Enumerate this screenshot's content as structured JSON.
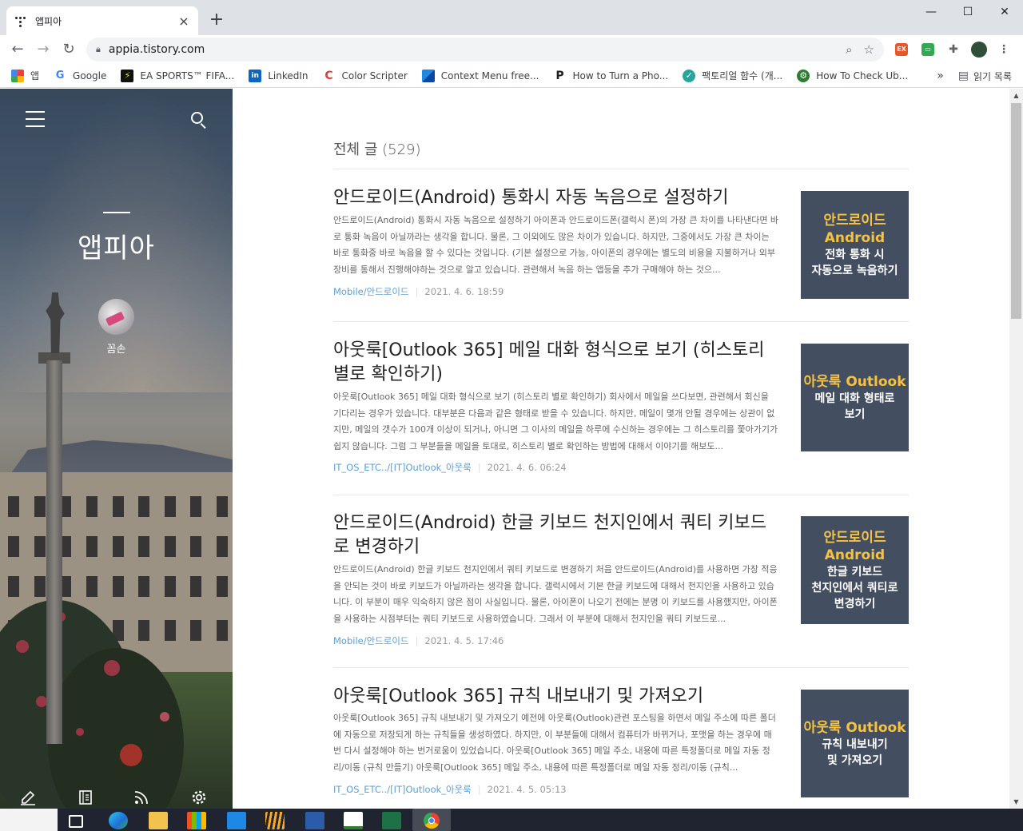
{
  "browser": {
    "tab_title": "앱피아",
    "tab_close": "×",
    "new_tab": "+",
    "window_controls": {
      "minimize": "—",
      "maximize": "☐",
      "close": "✕"
    },
    "url": "appia.tistory.com",
    "bookmarks": [
      {
        "label": "앱",
        "icon": "apps-grid-icon",
        "color": "#ea4335"
      },
      {
        "label": "Google",
        "icon": "google-icon",
        "color": "#4285f4"
      },
      {
        "label": "EA SPORTS™ FIFA...",
        "icon": "ea-sports-icon",
        "color": "#111111"
      },
      {
        "label": "LinkedIn",
        "icon": "linkedin-icon",
        "color": "#0a66c2"
      },
      {
        "label": "Color Scripter",
        "icon": "color-scripter-icon",
        "color": "#e53935"
      },
      {
        "label": "Context Menu free...",
        "icon": "context-menu-icon",
        "color": "#1e88e5"
      },
      {
        "label": "How to Turn a Pho...",
        "icon": "p-icon",
        "color": "#222222"
      },
      {
        "label": "팩토리얼 함수 (개...",
        "icon": "shield-check-icon",
        "color": "#26a69a"
      },
      {
        "label": "How To Check Ub...",
        "icon": "gear-badge-icon",
        "color": "#2e7d32"
      }
    ],
    "bookmarks_more": "»",
    "reading_list": "읽기 목록"
  },
  "blog": {
    "title": "앱피아",
    "author": "꼼손",
    "list_heading": "전체 글 (529)"
  },
  "posts": [
    {
      "title": "안드로이드(Android) 통화시 자동 녹음으로 설정하기",
      "excerpt": "안드로이드(Android) 통화시 자동 녹음으로 설정하기 아이폰과 안드로이드폰(갤럭시 폰)의 가장 큰 차이를 나타낸다면 바로 통화 녹음이 아닐까라는 생각을 합니다. 물론, 그 이외에도 많은 차이가 있습니다. 하지만, 그중에서도 가장 큰 차이는 바로 통화중 바로 녹음을 할 수 있다는 것입니다. (기본 설정으로 가능, 아이폰의 경우에는 별도의 비용을 지불하거나 외부 장비를 통해서 진행해야하는 것으로 알고 있습니다. 관련해서 녹음 하는 앱등을 추가 구매해야 하는 것으...",
      "category": "Mobile/안드로이드",
      "date": "2021. 4. 6. 18:59",
      "thumb_line1": "안드로이드\nAndroid",
      "thumb_line2": "전화 통화 시\n자동으로 녹음하기"
    },
    {
      "title": "아웃룩[Outlook 365] 메일 대화 형식으로 보기 (히스토리 별로 확인하기)",
      "excerpt": "아웃룩[Outlook 365] 메일 대화 형식으로 보기 (히스토리 별로 확인하기) 회사에서 메일을 쓰다보면, 관련해서 회신을 기다리는 경우가 있습니다. 대부분은 다음과 같은 형태로 받을 수 있습니다. 하지만, 메일이 몇개 안될 경우에는 상관이 없지만, 메일의 갯수가 100개 이상이 되거나, 아니면 그 이사의 메일을 하루에 수신하는 경우에는 그 히스토리를 쫓아가기가 쉽지 않습니다. 그럼 그 부분들을 메일을 토대로, 히스토리 별로 확인하는 방법에 대해서 이야기를 해보도...",
      "category": "IT_OS_ETC../[IT]Outlook_아웃룩",
      "date": "2021. 4. 6. 06:24",
      "thumb_line1": "아웃룩 Outlook",
      "thumb_line2": "메일 대화 형태로\n보기"
    },
    {
      "title": "안드로이드(Android) 한글 키보드 천지인에서 쿼티 키보드로 변경하기",
      "excerpt": "안드로이드(Android) 한글 키보드 천지인에서 쿼티 키보드로 변경하기 처음 안드로이드(Android)를 사용하면 가장 적응을 안되는 것이 바로 키보드가 아닐까라는 생각을 합니다. 갤럭시에서 기본 한글 키보드에 대해서 천지인을 사용하고 있습니다. 이 부분이 매우 익숙하지 않은 점이 사실입니다. 물론, 아이폰이 나오기 전에는 분명 이 키보드를 사용했지만, 아이폰을 사용하는 시점부터는 쿼티 키보드로 사용하였습니다. 그래서 이 부분에 대해서 천지인을 쿼티 키보드로...",
      "category": "Mobile/안드로이드",
      "date": "2021. 4. 5. 17:46",
      "thumb_line1": "안드로이드\nAndroid",
      "thumb_line2": "한글 키보드\n천지인에서 쿼티로\n변경하기"
    },
    {
      "title": "아웃룩[Outlook 365] 규칙 내보내기 및 가져오기",
      "excerpt": "아웃룩[Outlook 365] 규칙 내보내기 및 가져오기 예전에 아웃룩(Outlook)관련 포스팅을 하면서 메일 주소에 따른 폴더에 자동으로 저장되게 하는 규칙들을 생성하였다. 하지만, 이 부분들에 대해서 컴퓨터가 바뀌거나, 포맷을 하는 경우에 매번 다시 설정해야 하는 번거로움이 있었습니다. 아웃룩[Outlook 365] 메일 주소, 내용에 따른 특정폴더로 메일 자동 정리/이동 (규칙 만들기) 아웃룩[Outlook 365] 메일 주소, 내용에 따른 특정폴더로 메일 자동 정리/이동 (규칙...",
      "category": "IT_OS_ETC../[IT]Outlook_아웃룩",
      "date": "2021. 4. 5. 05:13",
      "thumb_line1": "아웃룩 Outlook",
      "thumb_line2": "규칙 내보내기\n및 가져오기"
    }
  ],
  "colors": {
    "thumb_bg": "#434f61",
    "thumb_accent": "#f5c242",
    "category_link": "#5f9ed1"
  }
}
